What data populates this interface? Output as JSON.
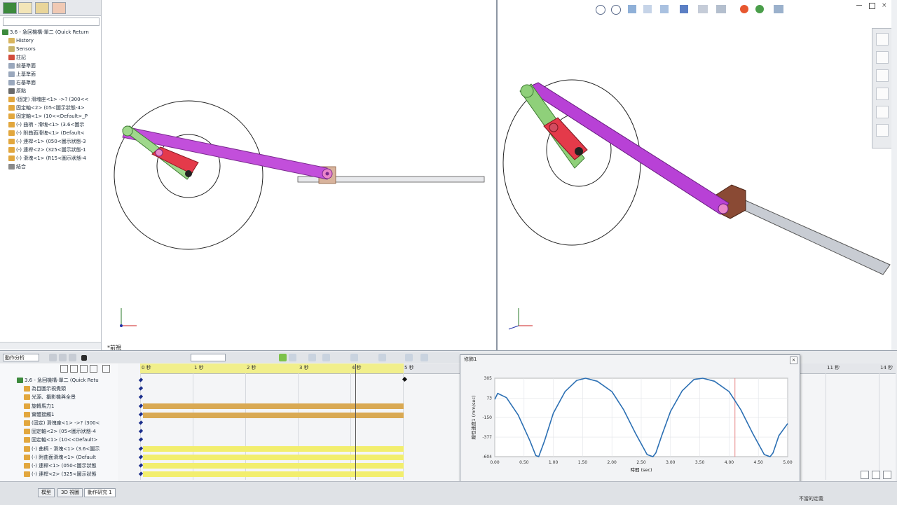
{
  "feature_tree": {
    "items": [
      {
        "label": "3.6 - 急回機構-單二 (Quick Return",
        "level": 0
      },
      {
        "label": "History",
        "level": 1
      },
      {
        "label": "Sensors",
        "level": 1
      },
      {
        "label": "註記",
        "level": 1
      },
      {
        "label": "前基準面",
        "level": 1
      },
      {
        "label": "上基準面",
        "level": 1
      },
      {
        "label": "右基準面",
        "level": 1
      },
      {
        "label": "原點",
        "level": 1
      },
      {
        "label": "(固定) 滑塊座<1> ->? (300<<",
        "level": 1
      },
      {
        "label": "固定軸<2> (05<圖示狀態-4>",
        "level": 1
      },
      {
        "label": "固定軸<1> (10<<Default>_P",
        "level": 1
      },
      {
        "label": "(-) 曲柄 - 滑塊<1> (3.6<圖示",
        "level": 1
      },
      {
        "label": "(-) 附曲面滑塊<1> (Default<",
        "level": 1
      },
      {
        "label": "(-) 連桿<1> (050<圖示狀態-3",
        "level": 1
      },
      {
        "label": "(-) 連桿<2> (325<圖示狀態-1",
        "level": 1
      },
      {
        "label": "(-) 滑塊<1> (R15<圖示狀態-4",
        "level": 1
      },
      {
        "label": "結合",
        "level": 1
      }
    ]
  },
  "viewport_left": {
    "view_label": "*前視"
  },
  "timeline": {
    "study_type": "動作分析",
    "ruler_labels": [
      "0 秒",
      "1 秒",
      "2 秒",
      "3 秒",
      "4 秒",
      "5 秒",
      "11 秒",
      "14 秒"
    ],
    "tree_items": [
      "3.6 - 急回機構-單二 (Quick Retu",
      "為目圖示視覺頭",
      "光源、攝影機與全景",
      "旋轉馬力1",
      "實體接觸1",
      "(固定) 滑塊座<1> ->? (300<",
      "固定軸<2> (05<圖示狀態-4",
      "固定軸<1> (10<<Default>",
      "(-) 曲柄 - 滑塊<1> (3.6<圖示",
      "(-) 附曲面滑塊<1> (Default",
      "(-) 連桿<1> (050<圖示狀態",
      "(-) 連桿<2> (325<圖示狀態"
    ],
    "bottom_tabs": [
      "模型",
      "3D 視圖",
      "動作研究 1"
    ],
    "status_text": "不當的定義"
  },
  "graph": {
    "title": "修飾1",
    "xlabel": "時間 (sec)",
    "ylabel": "線性速度1 (mm/sec)",
    "close_label": "×"
  },
  "chart_data": {
    "type": "line",
    "xlabel": "時間 (sec)",
    "ylabel": "線性速度1 (mm/sec)",
    "xlim": [
      0,
      5
    ],
    "ylim": [
      -604,
      305
    ],
    "x_ticks": [
      "0.00",
      "0.50",
      "1.00",
      "1.50",
      "2.00",
      "2.50",
      "3.00",
      "3.50",
      "4.00",
      "4.50",
      "5.00"
    ],
    "y_ticks": [
      "305",
      "73",
      "-150",
      "-377",
      "-604"
    ],
    "grid": true,
    "marker_time": 4.1,
    "series": [
      {
        "x": [
          0.0,
          0.05,
          0.2,
          0.4,
          0.6,
          0.7,
          0.75,
          0.85,
          1.0,
          1.2,
          1.4,
          1.55,
          1.75,
          2.0,
          2.2,
          2.4,
          2.6,
          2.7,
          2.75,
          2.85,
          3.0,
          3.2,
          3.4,
          3.55,
          3.75,
          4.0,
          4.2,
          4.4,
          4.6,
          4.7,
          4.75,
          4.85,
          5.0
        ],
        "y": [
          60,
          130,
          80,
          -120,
          -420,
          -590,
          -604,
          -420,
          -100,
          150,
          280,
          305,
          270,
          150,
          -60,
          -330,
          -580,
          -604,
          -560,
          -360,
          -80,
          160,
          290,
          305,
          270,
          150,
          -60,
          -330,
          -580,
          -604,
          -560,
          -360,
          -220
        ]
      }
    ]
  },
  "colors": {
    "feature_tab_active": "#3d8a3d",
    "crank_green": "#7ec86a",
    "slider_red": "#e43a4a",
    "link_magenta": "#c24fdb",
    "curve_blue": "#2b6fb3",
    "timeline_bar_gold": "#d9a953",
    "timeline_bar_yellow": "#f2ee6e",
    "marker_red": "#e88a8a"
  }
}
